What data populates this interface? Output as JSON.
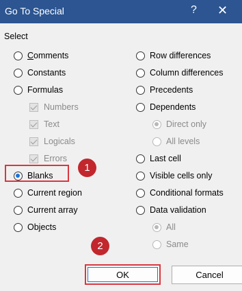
{
  "window": {
    "title": "Go To Special",
    "help_glyph": "?",
    "close_glyph": "✕"
  },
  "group": {
    "label": "Select"
  },
  "left_options": [
    {
      "label": "Comments",
      "selected": false
    },
    {
      "label": "Constants",
      "selected": false
    },
    {
      "label": "Formulas",
      "selected": false
    },
    {
      "label": "Blanks",
      "selected": true
    },
    {
      "label": "Current region",
      "selected": false
    },
    {
      "label": "Current array",
      "selected": false
    },
    {
      "label": "Objects",
      "selected": false
    }
  ],
  "formula_types": [
    {
      "label": "Numbers",
      "checked": true
    },
    {
      "label": "Text",
      "checked": true
    },
    {
      "label": "Logicals",
      "checked": true
    },
    {
      "label": "Errors",
      "checked": true
    }
  ],
  "right_options": [
    {
      "label": "Row differences",
      "selected": false
    },
    {
      "label": "Column differences",
      "selected": false
    },
    {
      "label": "Precedents",
      "selected": false
    },
    {
      "label": "Dependents",
      "selected": false
    },
    {
      "label": "Last cell",
      "selected": false
    },
    {
      "label": "Visible cells only",
      "selected": false
    },
    {
      "label": "Conditional formats",
      "selected": false
    },
    {
      "label": "Data validation",
      "selected": false
    }
  ],
  "dependents_scope": [
    {
      "label": "Direct only",
      "selected": true
    },
    {
      "label": "All levels",
      "selected": false
    }
  ],
  "validation_scope": [
    {
      "label": "All",
      "selected": true
    },
    {
      "label": "Same",
      "selected": false
    }
  ],
  "annotations": [
    {
      "label": "1"
    },
    {
      "label": "2"
    }
  ],
  "buttons": {
    "ok": "OK",
    "cancel": "Cancel"
  },
  "colors": {
    "titlebar": "#2c5591",
    "highlight": "#d9363e",
    "badge": "#c1272d",
    "selected_dot": "#1a73d9"
  }
}
